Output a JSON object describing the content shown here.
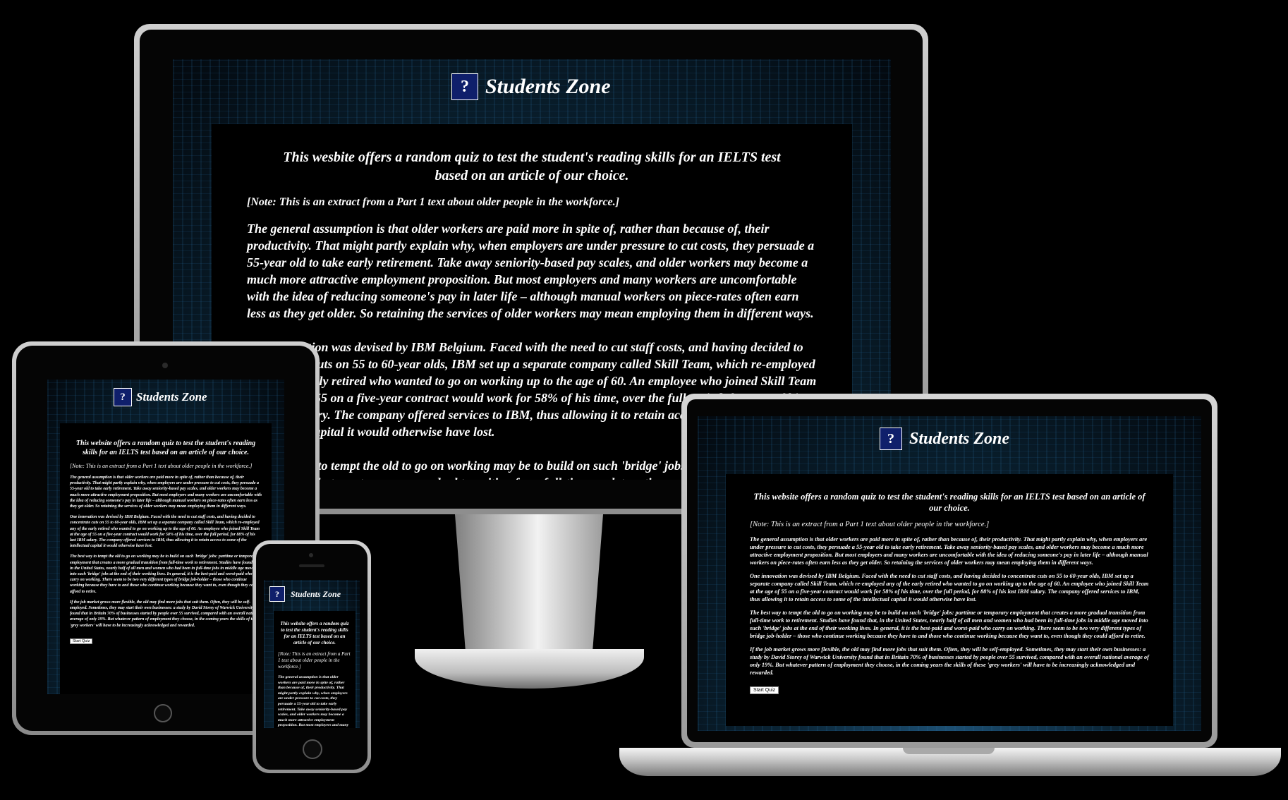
{
  "site": {
    "brand": "Students Zone",
    "logo_icon": "head-question-icon",
    "intro": "This wesbite offers a random quiz to test the student's reading skills for an IELTS test based on an article of our choice.",
    "intro_small": "This website offers a random quiz to test the student's reading skills for an IELTS test based on an article of our choice.",
    "note": "[Note: This is an extract from a Part 1 text about older people in the workforce.]",
    "paragraphs": [
      "The general assumption is that older workers are paid more in spite of, rather than because of, their productivity. That might partly explain why, when employers are under pressure to cut costs, they persuade a 55-year old to take early retirement. Take away seniority-based pay scales, and older workers may become a much more attractive employment proposition. But most employers and many workers are uncomfortable with the idea of reducing someone's pay in later life – although manual workers on piece-rates often earn less as they get older. So retaining the services of older workers may mean employing them in different ways.",
      "One innovation was devised by IBM Belgium. Faced with the need to cut staff costs, and having decided to concentrate cuts on 55 to 60-year olds, IBM set up a separate company called Skill Team, which re-employed any of the early retired who wanted to go on working up to the age of 60. An employee who joined Skill Team at the age of 55 on a five-year contract would work for 58% of his time, over the full period, for 88% of his last IBM salary. The company offered services to IBM, thus allowing it to retain access to some of the intellectual capital it would otherwise have lost.",
      "The best way to tempt the old to go on working may be to build on such 'bridge' jobs: parttime or temporary employment that creates a more gradual transition from full-time work to retirement. Studies have found that, in the United States, nearly half of all men and women who had been in full-time jobs in middle age moved into such 'bridge' jobs at the end of their working lives. In general, it is the best-paid and worst-paid who carry on working. There seem to be two very different types of bridge job-holder – those who continue working because they have to and those who continue working because they want to, even though they could afford to retire.",
      "If the job market grows more flexible, the old may find more jobs that suit them. Often, they will be self-employed. Sometimes, they may start their own businesses: a study by David Storey of Warwick University found that in Britain 70% of businesses started by people over 55 survived, compared with an overall national average of only 19%. But whatever pattern of employment they choose, in the coming years the skills of these 'grey workers' will have to be increasingly acknowledged and rewarded."
    ],
    "start_quiz": "Start Quiz"
  }
}
